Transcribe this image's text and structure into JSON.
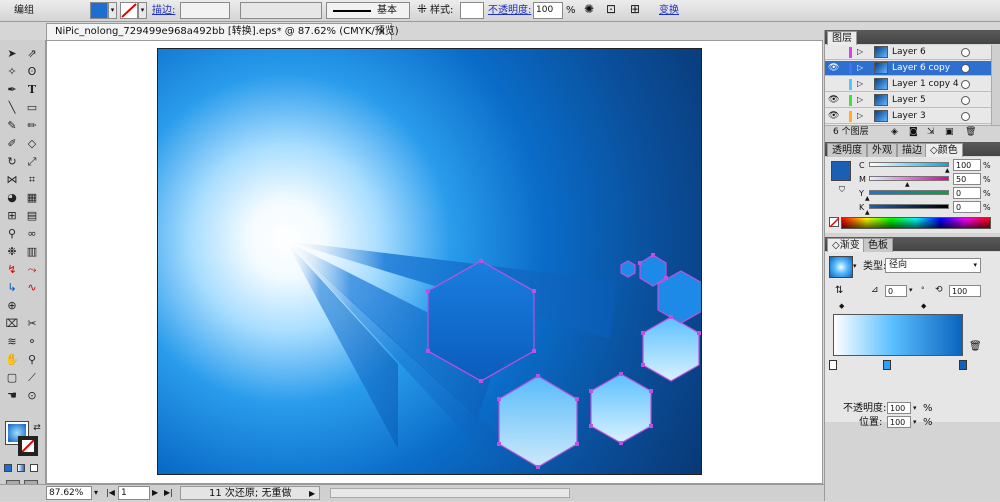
{
  "options_bar": {
    "mode_label": "编组",
    "stroke_label": "描边:",
    "basic_label": "基本",
    "style_label": "样式:",
    "opacity_label": "不透明度:",
    "opacity_value": "100",
    "percent": "%",
    "transform_label": "变换"
  },
  "document": {
    "tab_title": "NiPic_nolong_729499e968a492bb [转换].eps* @ 87.62% (CMYK/预览)",
    "close": "×"
  },
  "layers_panel": {
    "title": "图层",
    "layers": [
      {
        "name": "Layer 6",
        "color": "#e040e0",
        "visible": false,
        "selected": false
      },
      {
        "name": "Layer 6 copy",
        "color": "#4070ff",
        "visible": true,
        "selected": true
      },
      {
        "name": "Layer 1 copy 4",
        "color": "#50c8ff",
        "visible": false,
        "selected": false
      },
      {
        "name": "Layer 5",
        "color": "#40e040",
        "visible": true,
        "selected": false
      },
      {
        "name": "Layer 3",
        "color": "#ffb020",
        "visible": true,
        "selected": false
      }
    ],
    "count_label": "6 个图层"
  },
  "color_panel": {
    "tabs": [
      "透明度",
      "外观",
      "描边",
      "颜色"
    ],
    "active_tab": "颜色",
    "channels": [
      {
        "label": "C",
        "value": "100",
        "fill": 1.0,
        "color": "#00a8e8"
      },
      {
        "label": "M",
        "value": "50",
        "fill": 0.5,
        "color": "#e000a0"
      },
      {
        "label": "Y",
        "value": "0",
        "fill": 0.0,
        "color": "#e8e000"
      },
      {
        "label": "K",
        "value": "0",
        "fill": 0.0,
        "color": "#000000"
      }
    ],
    "percent": "%",
    "current_color": "#1a5fb4"
  },
  "gradient_panel": {
    "tabs": [
      "渐变",
      "色板"
    ],
    "active_tab": "渐变",
    "type_label": "类型:",
    "type_value": "径向",
    "angle_value": "0",
    "aspect_value": "100",
    "opacity_label": "不透明度:",
    "opacity_value": "100",
    "location_label": "位置:",
    "location_value": "100",
    "percent": "%",
    "start_color": "#ffffff",
    "end_color": "#0a64c0"
  },
  "status_bar": {
    "zoom": "87.62%",
    "page": "1",
    "undo_text": "11 次还原; 无重做"
  }
}
